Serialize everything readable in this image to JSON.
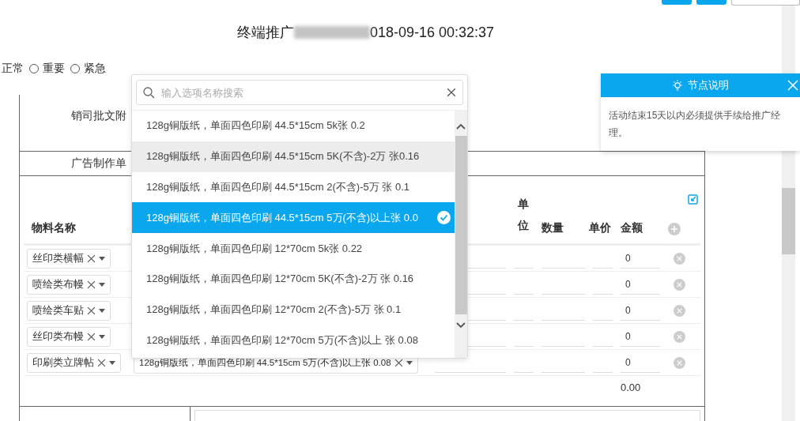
{
  "toolbar": {
    "buttons": [
      {
        "kind": "primary"
      },
      {
        "kind": "primary"
      },
      {
        "kind": "plain"
      }
    ]
  },
  "title": {
    "prefix": "终端推广",
    "suffix": "018-09-16 00:32:37"
  },
  "priority": {
    "cut_label": "正常",
    "options": [
      {
        "label": "重要",
        "selected": false
      },
      {
        "label": "紧急",
        "selected": false
      }
    ]
  },
  "form": {
    "rows": [
      {
        "label": "销司批文附",
        "kind": "tall"
      },
      {
        "label": "广告制作单",
        "kind": "short"
      }
    ]
  },
  "materials": {
    "columns": {
      "name": "物料名称",
      "unit": "单位",
      "qty": "数量",
      "price": "单价",
      "amount": "金额"
    },
    "rows": [
      {
        "name": "丝印类横幅",
        "amount": "0"
      },
      {
        "name": "喷绘类布幔",
        "amount": "0"
      },
      {
        "name": "喷绘类车贴",
        "amount": "0"
      },
      {
        "name": "丝印类布幔",
        "amount": "0"
      },
      {
        "name": "印刷类立牌帖",
        "material": "128g铜版纸，单面四色印刷 44.5*15cm 5万(不含)以上张 0.08",
        "amount": "0"
      }
    ],
    "total": "0.00"
  },
  "dropdown": {
    "placeholder": "输入选项名称搜索",
    "options": [
      {
        "label": "128g铜版纸，单面四色印刷 44.5*15cm 5k张 0.2",
        "hovered": false,
        "selected": false
      },
      {
        "label": "128g铜版纸，单面四色印刷 44.5*15cm 5K(不含)-2万 张0.16",
        "hovered": true,
        "selected": false
      },
      {
        "label": "128g铜版纸，单面四色印刷 44.5*15cm 2(不含)-5万 张 0.1",
        "hovered": false,
        "selected": false
      },
      {
        "label": "128g铜版纸，单面四色印刷 44.5*15cm 5万(不含)以上张 0.0",
        "hovered": false,
        "selected": true
      },
      {
        "label": "128g铜版纸，单面四色印刷 12*70cm 5k张 0.22",
        "hovered": false,
        "selected": false
      },
      {
        "label": "128g铜版纸，单面四色印刷 12*70cm 5K(不含)-2万 张 0.16",
        "hovered": false,
        "selected": false
      },
      {
        "label": "128g铜版纸，单面四色印刷 12*70cm 2(不含)-5万 张 0.1",
        "hovered": false,
        "selected": false
      },
      {
        "label": "128g铜版纸，单面四色印刷 12*70cm 5万(不含)以上 张 0.08",
        "hovered": false,
        "selected": false
      }
    ]
  },
  "notice": {
    "title": "节点说明",
    "text": "活动结束15天以内必须提供手续给推广经理。"
  }
}
